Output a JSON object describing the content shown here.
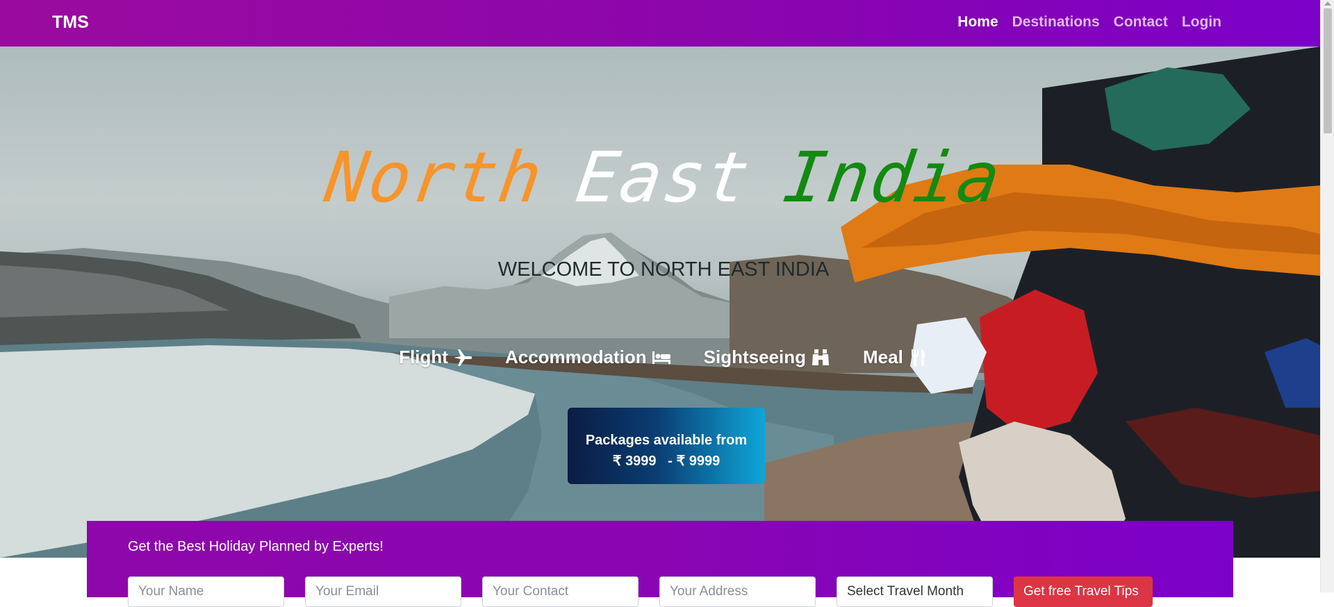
{
  "navbar": {
    "brand": "TMS",
    "links": [
      {
        "label": "Home",
        "active": true
      },
      {
        "label": "Destinations",
        "active": false
      },
      {
        "label": "Contact",
        "active": false
      },
      {
        "label": "Login",
        "active": false
      }
    ]
  },
  "hero": {
    "title_word_1": "North",
    "title_word_2": "East",
    "title_word_3": "India",
    "welcome": "WELCOME TO NORTH EAST INDIA",
    "features": [
      {
        "label": "Flight",
        "icon": "plane-icon"
      },
      {
        "label": "Accommodation",
        "icon": "bed-icon"
      },
      {
        "label": "Sightseeing",
        "icon": "binoculars-icon"
      },
      {
        "label": "Meal",
        "icon": "utensils-icon"
      }
    ],
    "package_line_1": "Packages available from",
    "package_line_2": "₹ 3999   - ₹ 9999"
  },
  "form": {
    "title": "Get the Best Holiday Planned by Experts!",
    "name_placeholder": "Your Name",
    "email_placeholder": "Your Email",
    "contact_placeholder": "Your Contact",
    "address_placeholder": "Your Address",
    "month_selected": "Select Travel Month",
    "submit_label": "Get free Travel Tips"
  },
  "colors": {
    "nav_gradient_start": "#9a0a9e",
    "nav_gradient_end": "#7b00c8",
    "title_north": "#f7942a",
    "title_east": "#ffffff",
    "title_india": "#138a12",
    "submit_button": "#dc3545"
  }
}
